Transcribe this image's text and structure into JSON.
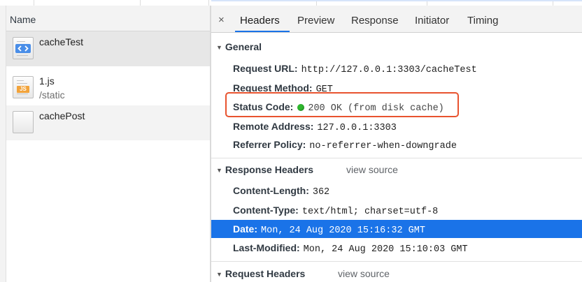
{
  "network_list": {
    "column_header": "Name",
    "rows": [
      {
        "name": "cacheTest",
        "path": "",
        "icon": "html-document-icon",
        "selected": true
      },
      {
        "name": "1.js",
        "path": "/static",
        "icon": "js-file-icon",
        "selected": false
      },
      {
        "name": "cachePost",
        "path": "",
        "icon": "blank-file-icon",
        "selected": false
      }
    ]
  },
  "details": {
    "close_label": "×",
    "tabs": [
      "Headers",
      "Preview",
      "Response",
      "Initiator",
      "Timing"
    ],
    "active_tab": "Headers",
    "general": {
      "title": "General",
      "request_url": {
        "key": "Request URL:",
        "value": "http://127.0.0.1:3303/cacheTest"
      },
      "request_method": {
        "key": "Request Method:",
        "value": "GET"
      },
      "status_code": {
        "key": "Status Code:",
        "value": "200 OK (from disk cache)",
        "status_color": "#2eb82e"
      },
      "remote_address": {
        "key": "Remote Address:",
        "value": "127.0.0.1:3303"
      },
      "referrer_policy": {
        "key": "Referrer Policy:",
        "value": "no-referrer-when-downgrade"
      }
    },
    "response_headers": {
      "title": "Response Headers",
      "view_source": "view source",
      "content_length": {
        "key": "Content-Length:",
        "value": "362"
      },
      "content_type": {
        "key": "Content-Type:",
        "value": "text/html; charset=utf-8"
      },
      "date": {
        "key": "Date:",
        "value": "Mon, 24 Aug 2020 15:16:32 GMT",
        "selected": true
      },
      "last_modified": {
        "key": "Last-Modified:",
        "value": "Mon, 24 Aug 2020 15:10:03 GMT"
      }
    },
    "request_headers": {
      "title": "Request Headers",
      "view_source": "view source"
    }
  },
  "colors": {
    "selection": "#1a73e8",
    "highlight_box": "#e8532f",
    "status_ok": "#2eb82e"
  }
}
